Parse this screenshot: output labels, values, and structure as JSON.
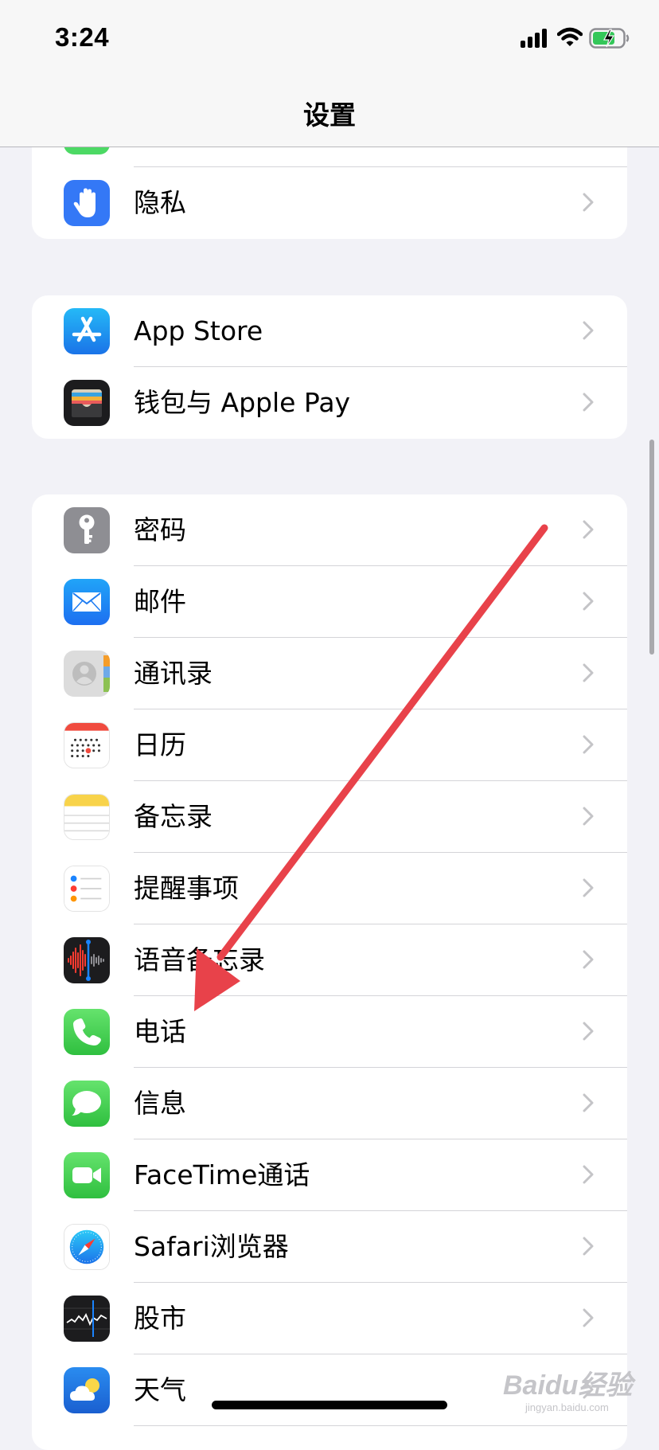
{
  "status_bar": {
    "time": "3:24"
  },
  "nav": {
    "title": "设置"
  },
  "groups": [
    {
      "rows": [
        {
          "label": "隐私",
          "icon": "hand-icon"
        }
      ]
    },
    {
      "rows": [
        {
          "label": "App Store",
          "icon": "app-store-icon"
        },
        {
          "label": "钱包与 Apple Pay",
          "icon": "wallet-icon"
        }
      ]
    },
    {
      "rows": [
        {
          "label": "密码",
          "icon": "key-icon"
        },
        {
          "label": "邮件",
          "icon": "mail-icon"
        },
        {
          "label": "通讯录",
          "icon": "contacts-icon"
        },
        {
          "label": "日历",
          "icon": "calendar-icon"
        },
        {
          "label": "备忘录",
          "icon": "notes-icon"
        },
        {
          "label": "提醒事项",
          "icon": "reminders-icon"
        },
        {
          "label": "语音备忘录",
          "icon": "voice-memos-icon"
        },
        {
          "label": "电话",
          "icon": "phone-icon"
        },
        {
          "label": "信息",
          "icon": "messages-icon"
        },
        {
          "label": "FaceTime通话",
          "icon": "facetime-icon"
        },
        {
          "label": "Safari浏览器",
          "icon": "safari-icon"
        },
        {
          "label": "股市",
          "icon": "stocks-icon"
        },
        {
          "label": "天气",
          "icon": "weather-icon"
        }
      ]
    }
  ],
  "watermark": {
    "brand": "Baidu经验",
    "site": "jingyan.baidu.com"
  },
  "colors": {
    "background": "#f2f2f7",
    "annotation_arrow": "#e8424a",
    "privacy_blue": "#3478f6",
    "phone_green": "#4cd964"
  }
}
